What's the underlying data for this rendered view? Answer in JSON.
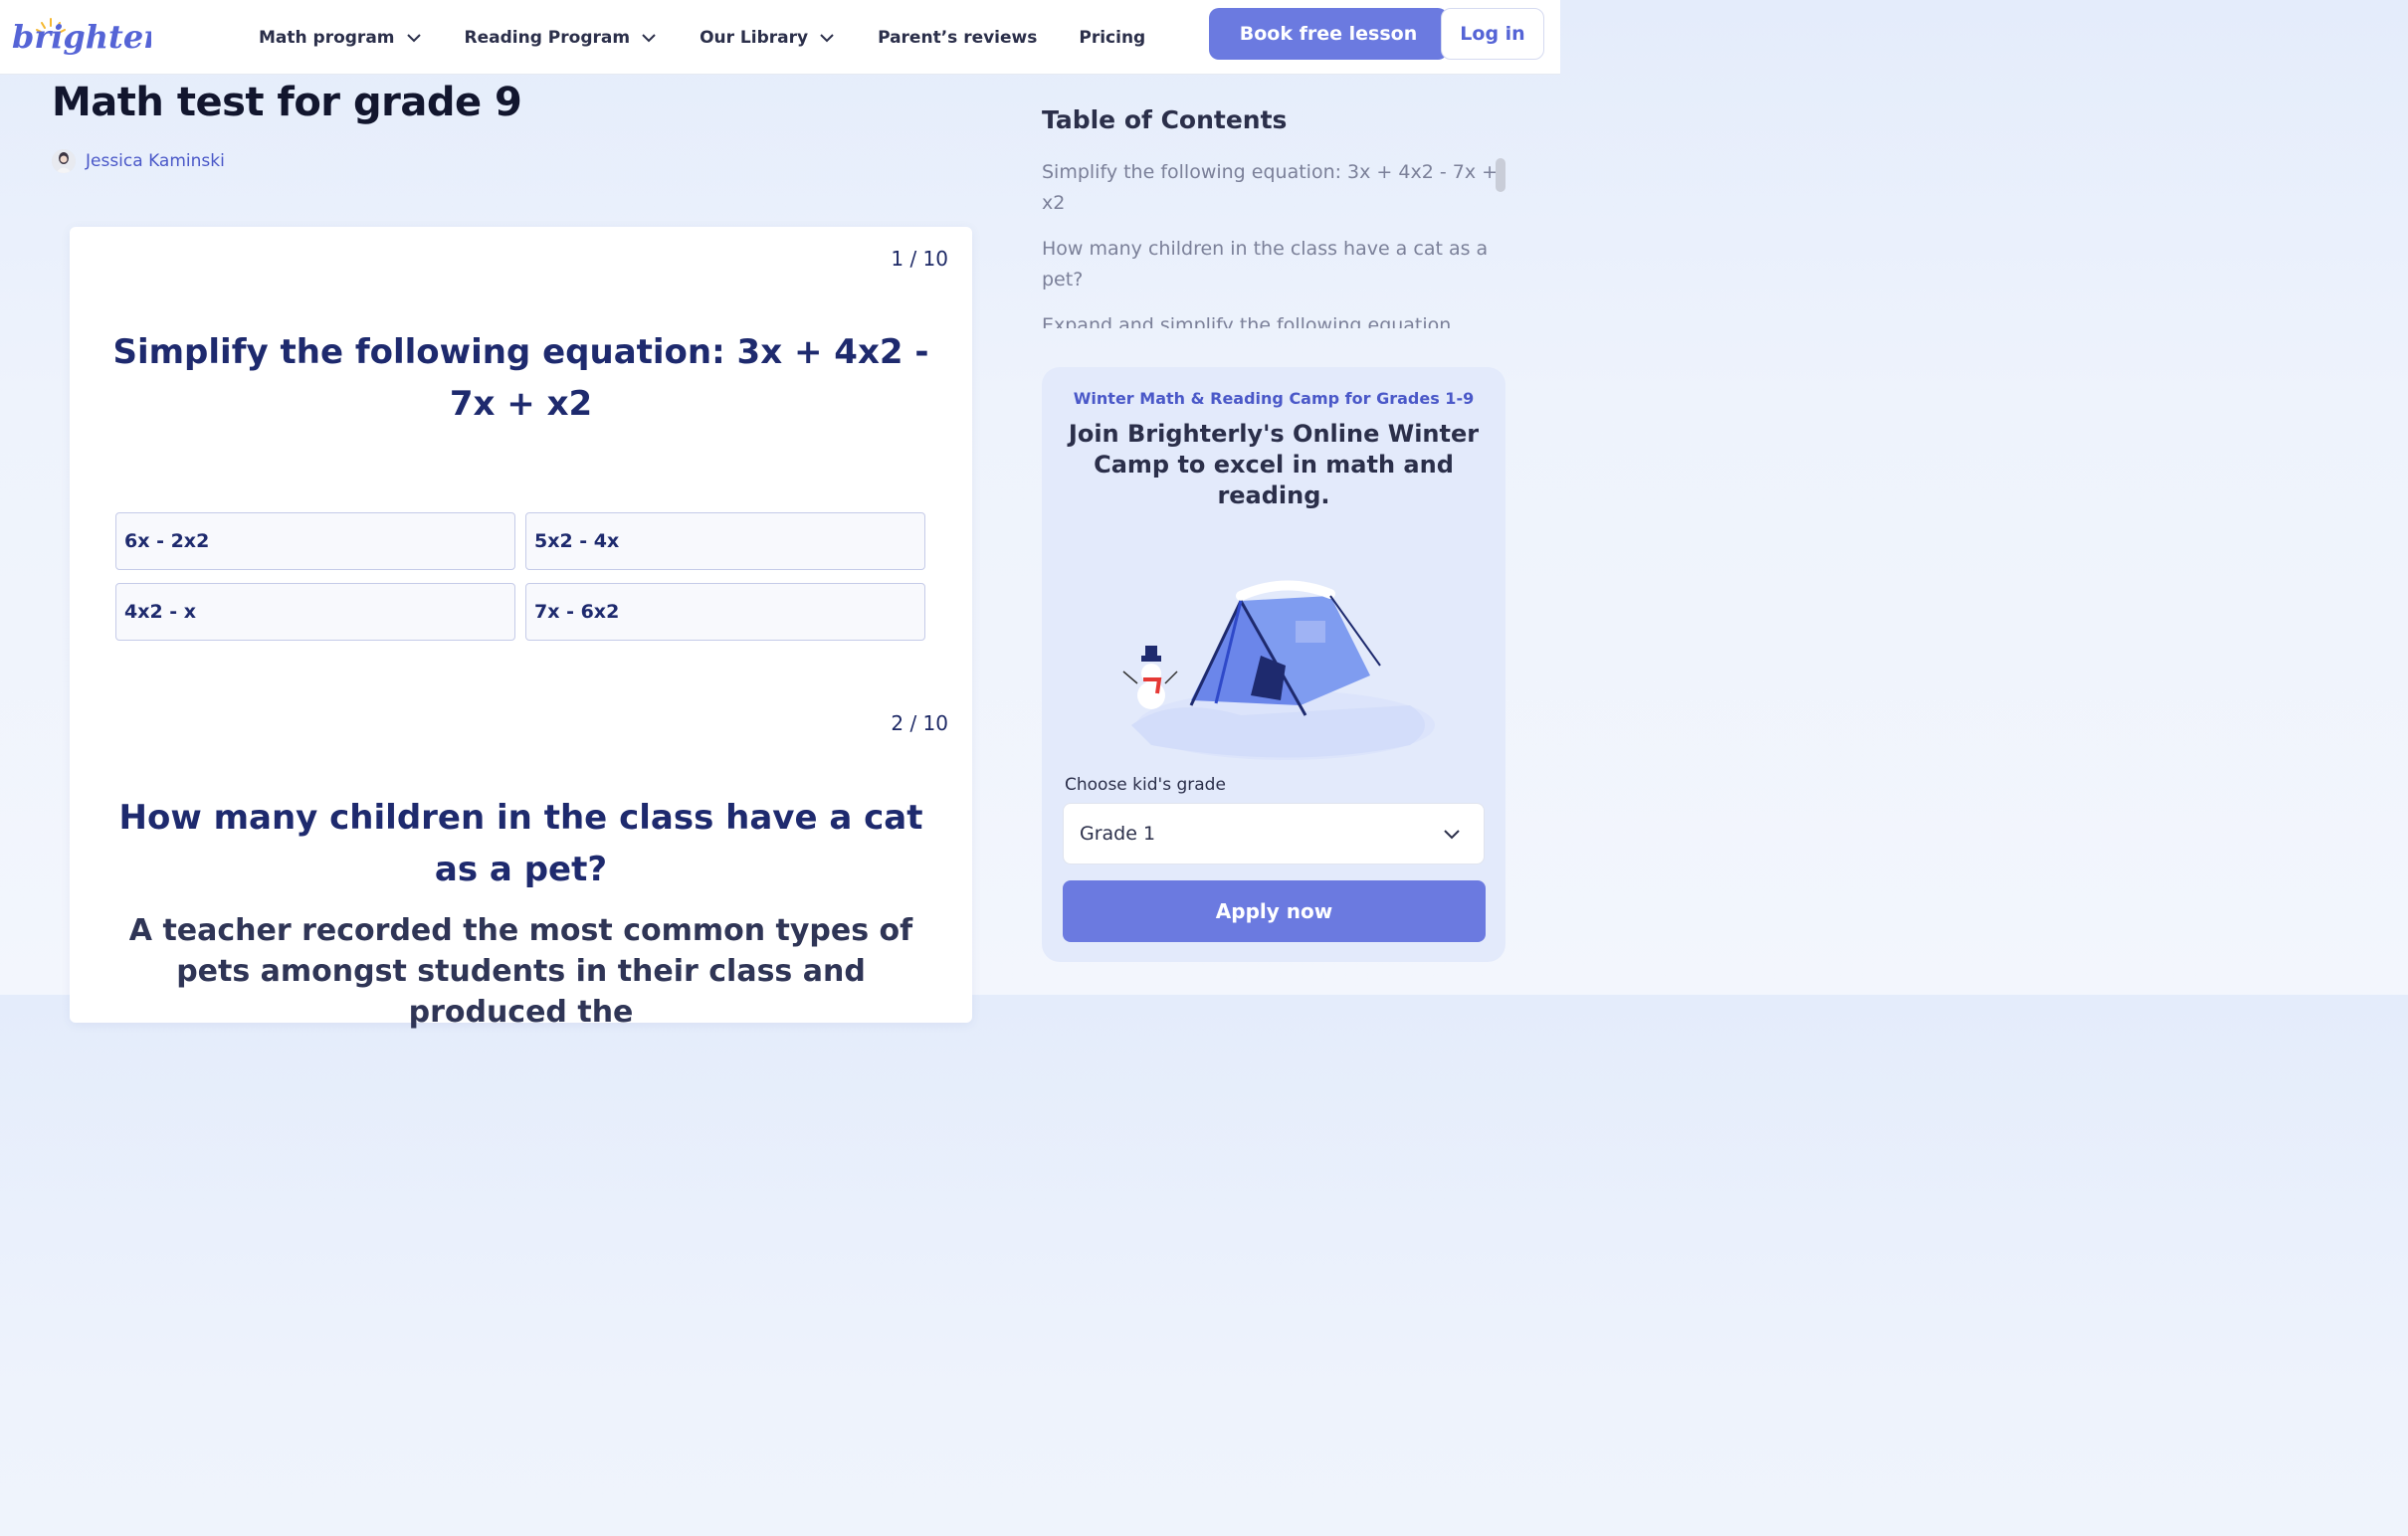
{
  "header": {
    "logo_text": "brighterly",
    "nav": [
      {
        "label": "Math program",
        "has_dropdown": true
      },
      {
        "label": "Reading Program",
        "has_dropdown": true
      },
      {
        "label": "Our Library",
        "has_dropdown": true
      },
      {
        "label": "Parent’s reviews",
        "has_dropdown": false
      },
      {
        "label": "Pricing",
        "has_dropdown": false
      }
    ],
    "book_label": "Book free lesson",
    "login_label": "Log in"
  },
  "page": {
    "title": "Math test for grade 9",
    "author": "Jessica Kaminski"
  },
  "quiz": {
    "questions": [
      {
        "counter": "1 / 10",
        "text": "Simplify the following equation: 3x + 4x2 - 7x + x2",
        "options": [
          "6x - 2x2",
          "5x2 - 4x",
          "4x2 - x",
          "7x - 6x2"
        ]
      },
      {
        "counter": "2 / 10",
        "text": "How many children in the class have a cat as a pet?",
        "body": "A teacher recorded the most common types of pets amongst students in their class and produced the"
      }
    ]
  },
  "toc": {
    "title": "Table of Contents",
    "items": [
      "Simplify the following equation: 3x + 4x2 - 7x + x2",
      "How many children in the class have a cat as a pet?",
      "Expand and simplify the following equation"
    ]
  },
  "promo": {
    "subtitle": "Winter Math & Reading Camp for Grades 1-9",
    "title": "Join Brighterly's Online Winter Camp to excel in math and reading.",
    "grade_label": "Choose kid's grade",
    "grade_value": "Grade 1",
    "apply_label": "Apply now"
  },
  "colors": {
    "accent": "#6b7ae0",
    "navy": "#1e2a6e",
    "logo": "#5564d6",
    "logo_sun": "#f5b82e"
  }
}
